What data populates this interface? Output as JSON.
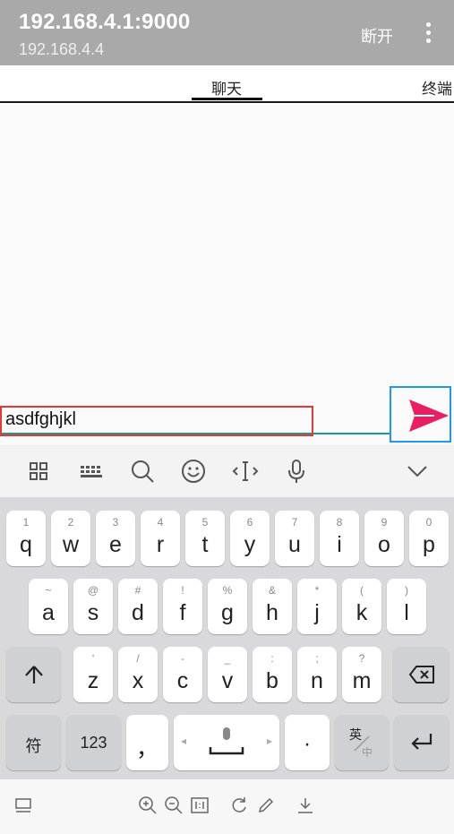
{
  "app_bar": {
    "title": "192.168.4.1:9000",
    "subtitle": "192.168.4.4",
    "disconnect_label": "断开",
    "more_icon": "more-vert-icon"
  },
  "tabs": [
    {
      "label": "聊天",
      "selected": true
    },
    {
      "label": "终端",
      "selected": false
    }
  ],
  "input": {
    "value": "asdfghjkl"
  },
  "send_button": {
    "icon": "send-icon",
    "color": "#e91e63"
  },
  "keyboard_toolbar": [
    "grid-icon",
    "keyboard-icon",
    "search-icon",
    "emoji-icon",
    "cursor-icon",
    "mic-icon",
    "collapse-icon"
  ],
  "keyboard": {
    "row1": [
      {
        "hint": "1",
        "key": "q"
      },
      {
        "hint": "2",
        "key": "w"
      },
      {
        "hint": "3",
        "key": "e"
      },
      {
        "hint": "4",
        "key": "r"
      },
      {
        "hint": "5",
        "key": "t"
      },
      {
        "hint": "6",
        "key": "y"
      },
      {
        "hint": "7",
        "key": "u"
      },
      {
        "hint": "8",
        "key": "i"
      },
      {
        "hint": "9",
        "key": "o"
      },
      {
        "hint": "0",
        "key": "p"
      }
    ],
    "row2": [
      {
        "hint": "~",
        "key": "a"
      },
      {
        "hint": "@",
        "key": "s"
      },
      {
        "hint": "#",
        "key": "d"
      },
      {
        "hint": "!",
        "key": "f"
      },
      {
        "hint": "%",
        "key": "g"
      },
      {
        "hint": "&",
        "key": "h"
      },
      {
        "hint": "*",
        "key": "j"
      },
      {
        "hint": "(",
        "key": "k"
      },
      {
        "hint": ")",
        "key": "l"
      }
    ],
    "row3": [
      {
        "hint": "'",
        "key": "z"
      },
      {
        "hint": "/",
        "key": "x"
      },
      {
        "hint": "-",
        "key": "c"
      },
      {
        "hint": "_",
        "key": "v"
      },
      {
        "hint": ":",
        "key": "b"
      },
      {
        "hint": ";",
        "key": "n"
      },
      {
        "hint": "?",
        "key": "m"
      }
    ],
    "symbols_label": "符",
    "numbers_label": "123",
    "comma_label": "，",
    "period_label": "·",
    "lang_top": "英",
    "lang_bottom": "中"
  },
  "bottom_bar": [
    "screen-icon",
    "zoom-in-icon",
    "zoom-out-icon",
    "actual-size-icon",
    "rotate-icon",
    "edit-icon",
    "download-icon"
  ]
}
